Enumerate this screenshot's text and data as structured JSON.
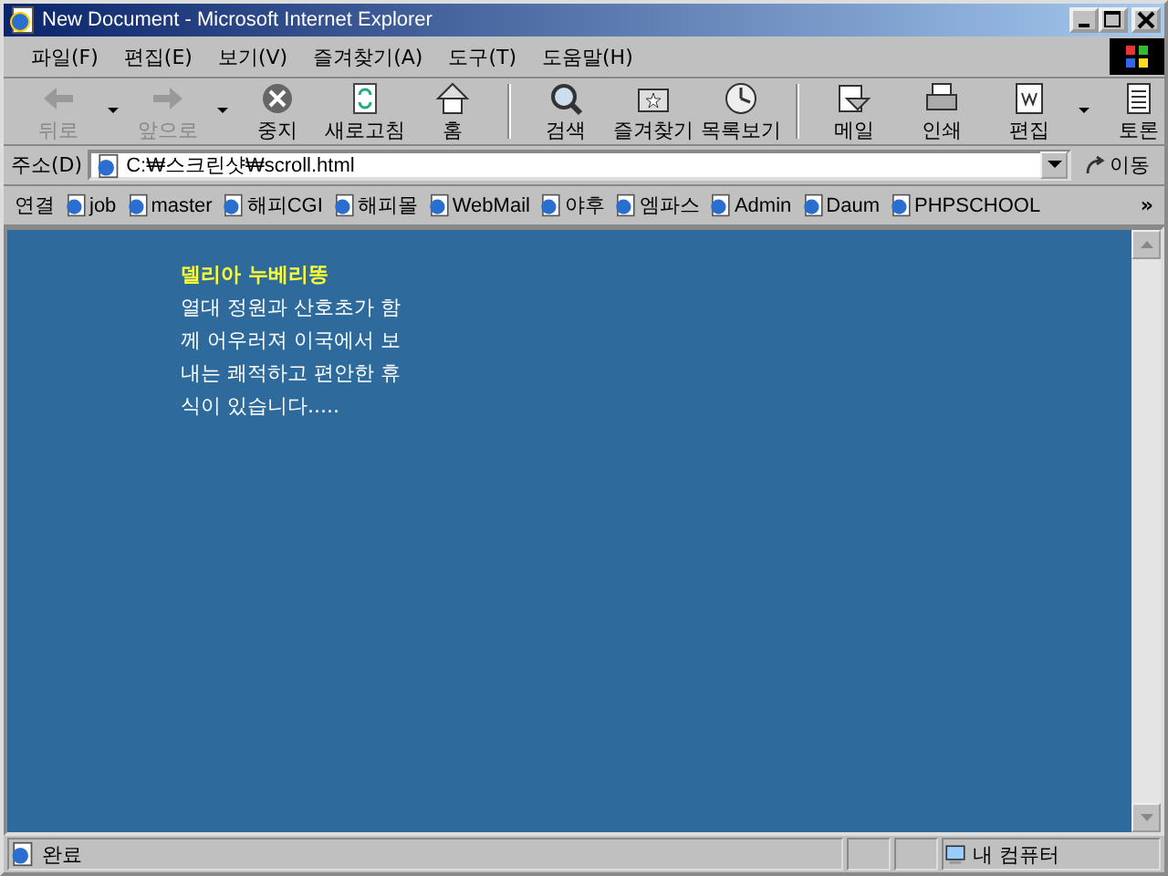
{
  "window": {
    "title": "New Document - Microsoft Internet Explorer"
  },
  "menu": [
    "파일(F)",
    "편집(E)",
    "보기(V)",
    "즐겨찾기(A)",
    "도구(T)",
    "도움말(H)"
  ],
  "toolbar": [
    {
      "kind": "back",
      "label": "뒤로",
      "disabled": true,
      "dropdown": true
    },
    {
      "kind": "forward",
      "label": "앞으로",
      "disabled": true,
      "dropdown": true
    },
    {
      "kind": "stop",
      "label": "중지",
      "disabled": false,
      "dropdown": false
    },
    {
      "kind": "refresh",
      "label": "새로고침",
      "disabled": false,
      "dropdown": false
    },
    {
      "kind": "home",
      "label": "홈",
      "disabled": false,
      "dropdown": false
    },
    {
      "kind": "sep"
    },
    {
      "kind": "search",
      "label": "검색",
      "disabled": false,
      "dropdown": false
    },
    {
      "kind": "favorites",
      "label": "즐겨찾기",
      "disabled": false,
      "dropdown": false
    },
    {
      "kind": "history",
      "label": "목록보기",
      "disabled": false,
      "dropdown": false
    },
    {
      "kind": "sep"
    },
    {
      "kind": "mail",
      "label": "메일",
      "disabled": false,
      "dropdown": false
    },
    {
      "kind": "print",
      "label": "인쇄",
      "disabled": false,
      "dropdown": false
    },
    {
      "kind": "edit",
      "label": "편집",
      "disabled": false,
      "dropdown": true
    },
    {
      "kind": "discuss",
      "label": "토론",
      "disabled": false,
      "dropdown": false
    }
  ],
  "address": {
    "label": "주소(D)",
    "value": "C:₩스크린샷₩scroll.html",
    "go": "이동"
  },
  "links": {
    "label": "연결",
    "items": [
      "job",
      "master",
      "해피CGI",
      "해피몰",
      "WebMail",
      "야후",
      "엠파스",
      "Admin",
      "Daum",
      "PHPSCHOOL"
    ],
    "more": "»"
  },
  "content": {
    "title": "델리아 누베리똥",
    "lines": [
      "열대 정원과 산호초가 함",
      "께 어우러져 이국에서 보",
      "내는 쾌적하고 편안한 휴",
      "식이 있습니다....."
    ]
  },
  "status_bar": {
    "text": "완료",
    "zone": "내 컴퓨터"
  }
}
